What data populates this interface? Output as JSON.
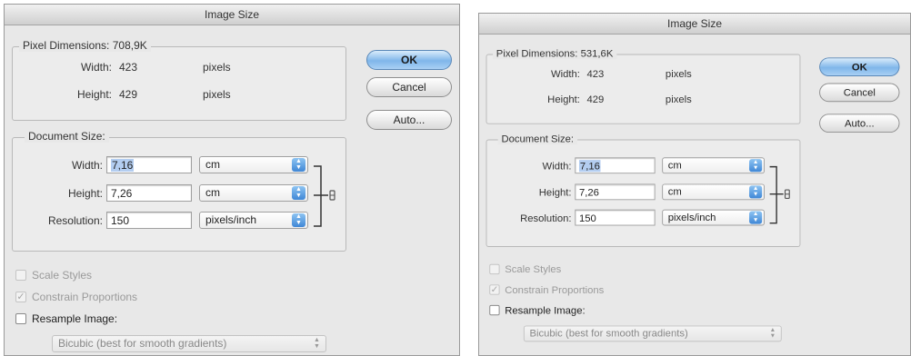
{
  "dialogs": [
    {
      "title": "Image Size",
      "pixel_dimensions": {
        "label": "Pixel Dimensions:",
        "value": "708,9K"
      },
      "pixel_width": {
        "label": "Width:",
        "value": "423",
        "unit": "pixels"
      },
      "pixel_height": {
        "label": "Height:",
        "value": "429",
        "unit": "pixels"
      },
      "buttons": {
        "ok": "OK",
        "cancel": "Cancel",
        "auto": "Auto..."
      },
      "document_size": {
        "label": "Document Size:",
        "width": {
          "label": "Width:",
          "value": "7,16",
          "unit": "cm"
        },
        "height": {
          "label": "Height:",
          "value": "7,26",
          "unit": "cm"
        },
        "resolution": {
          "label": "Resolution:",
          "value": "150",
          "unit": "pixels/inch"
        }
      },
      "options": {
        "scale_styles": "Scale Styles",
        "constrain_proportions": "Constrain Proportions",
        "resample_image": "Resample Image:",
        "resample_method": "Bicubic (best for smooth gradients)"
      }
    },
    {
      "title": "Image Size",
      "pixel_dimensions": {
        "label": "Pixel Dimensions:",
        "value": "531,6K"
      },
      "pixel_width": {
        "label": "Width:",
        "value": "423",
        "unit": "pixels"
      },
      "pixel_height": {
        "label": "Height:",
        "value": "429",
        "unit": "pixels"
      },
      "buttons": {
        "ok": "OK",
        "cancel": "Cancel",
        "auto": "Auto..."
      },
      "document_size": {
        "label": "Document Size:",
        "width": {
          "label": "Width:",
          "value": "7,16",
          "unit": "cm"
        },
        "height": {
          "label": "Height:",
          "value": "7,26",
          "unit": "cm"
        },
        "resolution": {
          "label": "Resolution:",
          "value": "150",
          "unit": "pixels/inch"
        }
      },
      "options": {
        "scale_styles": "Scale Styles",
        "constrain_proportions": "Constrain Proportions",
        "resample_image": "Resample Image:",
        "resample_method": "Bicubic (best for smooth gradients)"
      }
    }
  ],
  "icons": {
    "chain_link": "link-icon",
    "checkmark": "✓",
    "stepper_up": "▲",
    "stepper_down": "▼"
  },
  "colors": {
    "default_button": "#7fb6ea",
    "selection_highlight": "#b3cdf0",
    "dialog_background": "#e8e8e8"
  }
}
